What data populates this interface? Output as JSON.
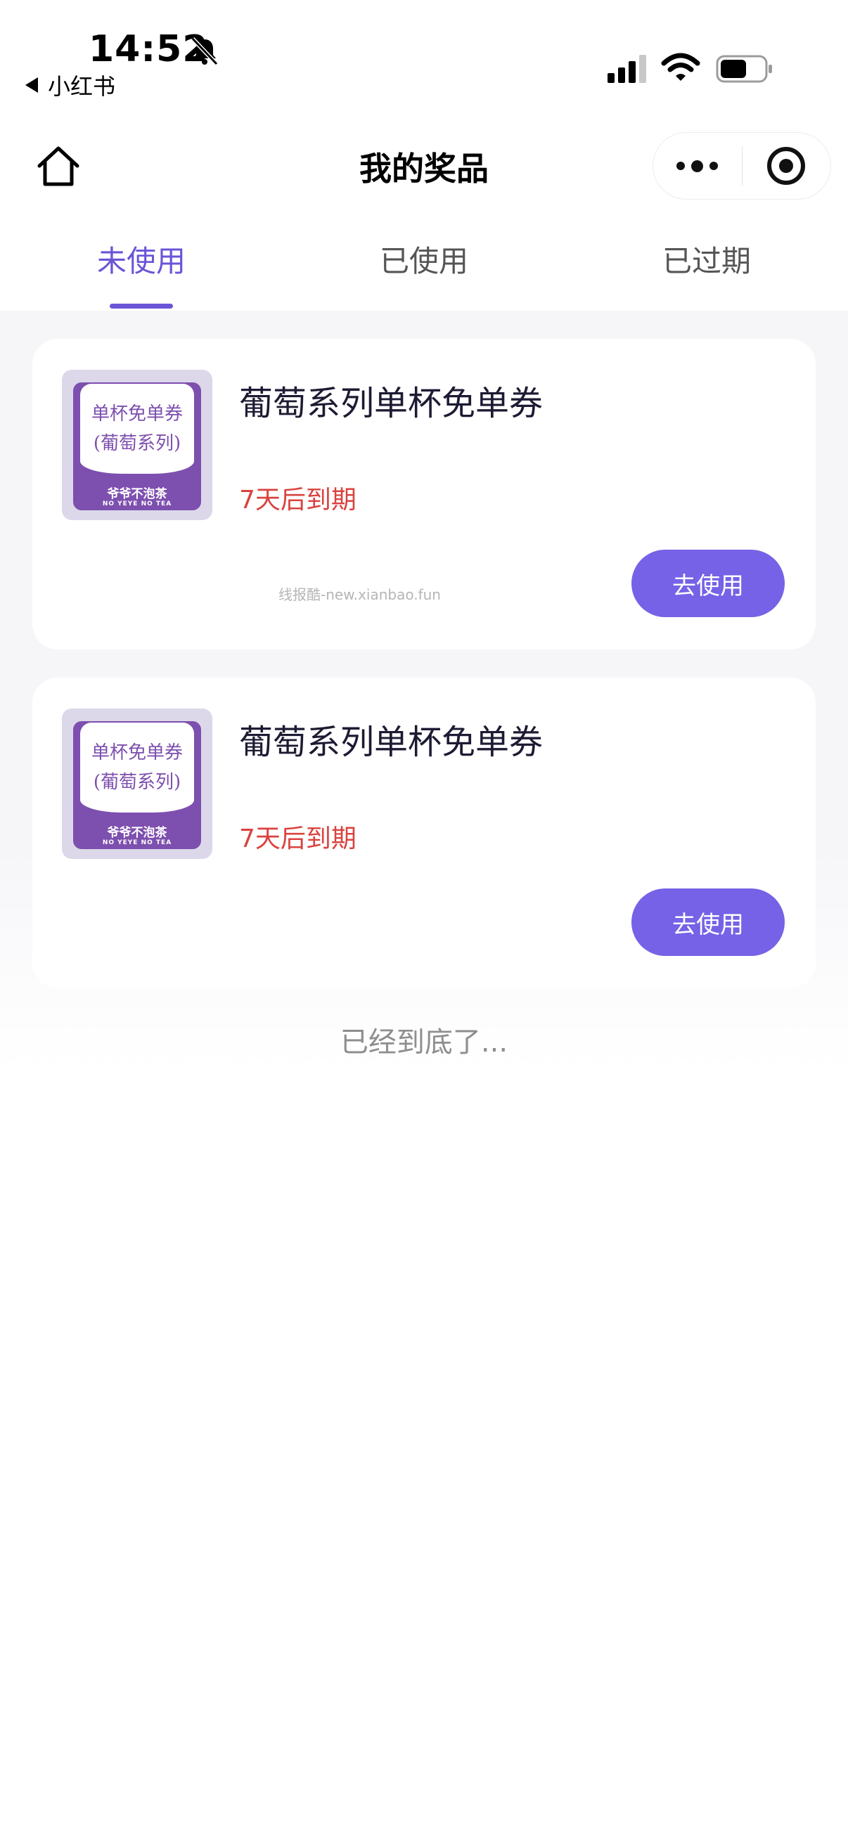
{
  "status_bar": {
    "time": "14:52",
    "back_app": "小红书"
  },
  "nav": {
    "title": "我的奖品"
  },
  "tabs": [
    {
      "label": "未使用",
      "active": true
    },
    {
      "label": "已使用",
      "active": false
    },
    {
      "label": "已过期",
      "active": false
    }
  ],
  "cards": [
    {
      "coupon_line1": "单杯免单券",
      "coupon_line2": "(葡萄系列)",
      "coupon_brand": "爷爷不泡茶",
      "coupon_brand_en": "NO YEYE NO TEA",
      "title": "葡萄系列单杯免单券",
      "expire": "7天后到期",
      "button": "去使用"
    },
    {
      "coupon_line1": "单杯免单券",
      "coupon_line2": "(葡萄系列)",
      "coupon_brand": "爷爷不泡茶",
      "coupon_brand_en": "NO YEYE NO TEA",
      "title": "葡萄系列单杯免单券",
      "expire": "7天后到期",
      "button": "去使用"
    }
  ],
  "watermark": "线报酷-new.xianbao.fun",
  "end_text": "已经到底了...",
  "colors": {
    "accent": "#6a55d8",
    "button": "#7562e6",
    "expire": "#d9433f",
    "coupon_purple": "#7d4fae"
  },
  "icons": [
    "bell-muted-icon",
    "signal-icon",
    "wifi-icon",
    "battery-icon",
    "home-icon",
    "more-icon",
    "close-target-icon"
  ]
}
